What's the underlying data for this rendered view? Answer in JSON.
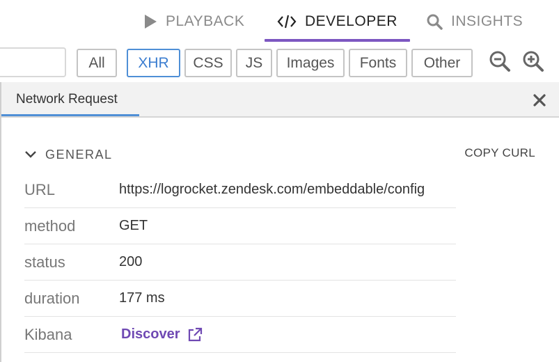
{
  "tabs": {
    "playback": "PLAYBACK",
    "developer": "DEVELOPER",
    "insights": "INSIGHTS",
    "active": "developer"
  },
  "filters": {
    "search_value": "",
    "buttons": [
      "All",
      "XHR",
      "CSS",
      "JS",
      "Images",
      "Fonts",
      "Other"
    ],
    "active": "XHR"
  },
  "panel": {
    "tab_label": "Network Request",
    "section_title": "GENERAL",
    "copy_curl_label": "COPY CURL",
    "rows": [
      {
        "key": "URL",
        "value": "https://logrocket.zendesk.com/embeddable/config"
      },
      {
        "key": "method",
        "value": "GET"
      },
      {
        "key": "status",
        "value": "200"
      },
      {
        "key": "duration",
        "value": "177 ms"
      },
      {
        "key": "Kibana",
        "value": "Discover"
      }
    ]
  },
  "colors": {
    "accent_purple": "#7d57c1",
    "active_blue": "#4f8fd6",
    "link_purple": "#6f49b3"
  }
}
